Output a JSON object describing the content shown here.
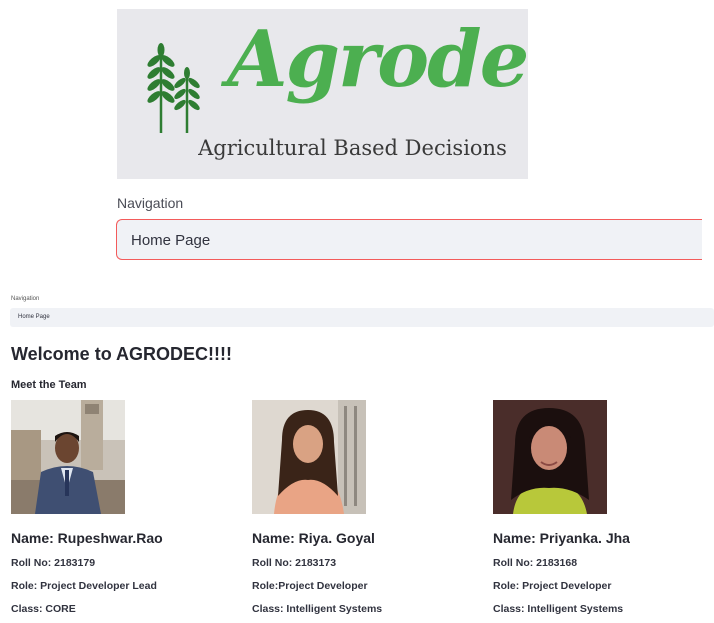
{
  "logo": {
    "wordmark": "Agrodec",
    "tagline": "Agricultural Based Decisions",
    "brand_color": "#4caf50"
  },
  "navigation_large": {
    "label": "Navigation",
    "selected": "Home Page",
    "border_color": "#f35b5b"
  },
  "navigation_small": {
    "label": "Navigation",
    "selected": "Home Page"
  },
  "welcome_title": "Welcome to AGRODEC!!!!",
  "team_heading": "Meet the Team",
  "team": [
    {
      "name": "Name: Rupeshwar.Rao",
      "roll": "Roll No: 2183179",
      "role": "Role: Project Developer Lead",
      "class": "Class: CORE"
    },
    {
      "name": "Name: Riya. Goyal",
      "roll": "Roll No: 2183173",
      "role": "Role:Project Developer",
      "class": "Class: Intelligent Systems"
    },
    {
      "name": "Name: Priyanka. Jha",
      "roll": "Roll No: 2183168",
      "role": "Role: Project Developer",
      "class": "Class: Intelligent Systems"
    }
  ]
}
